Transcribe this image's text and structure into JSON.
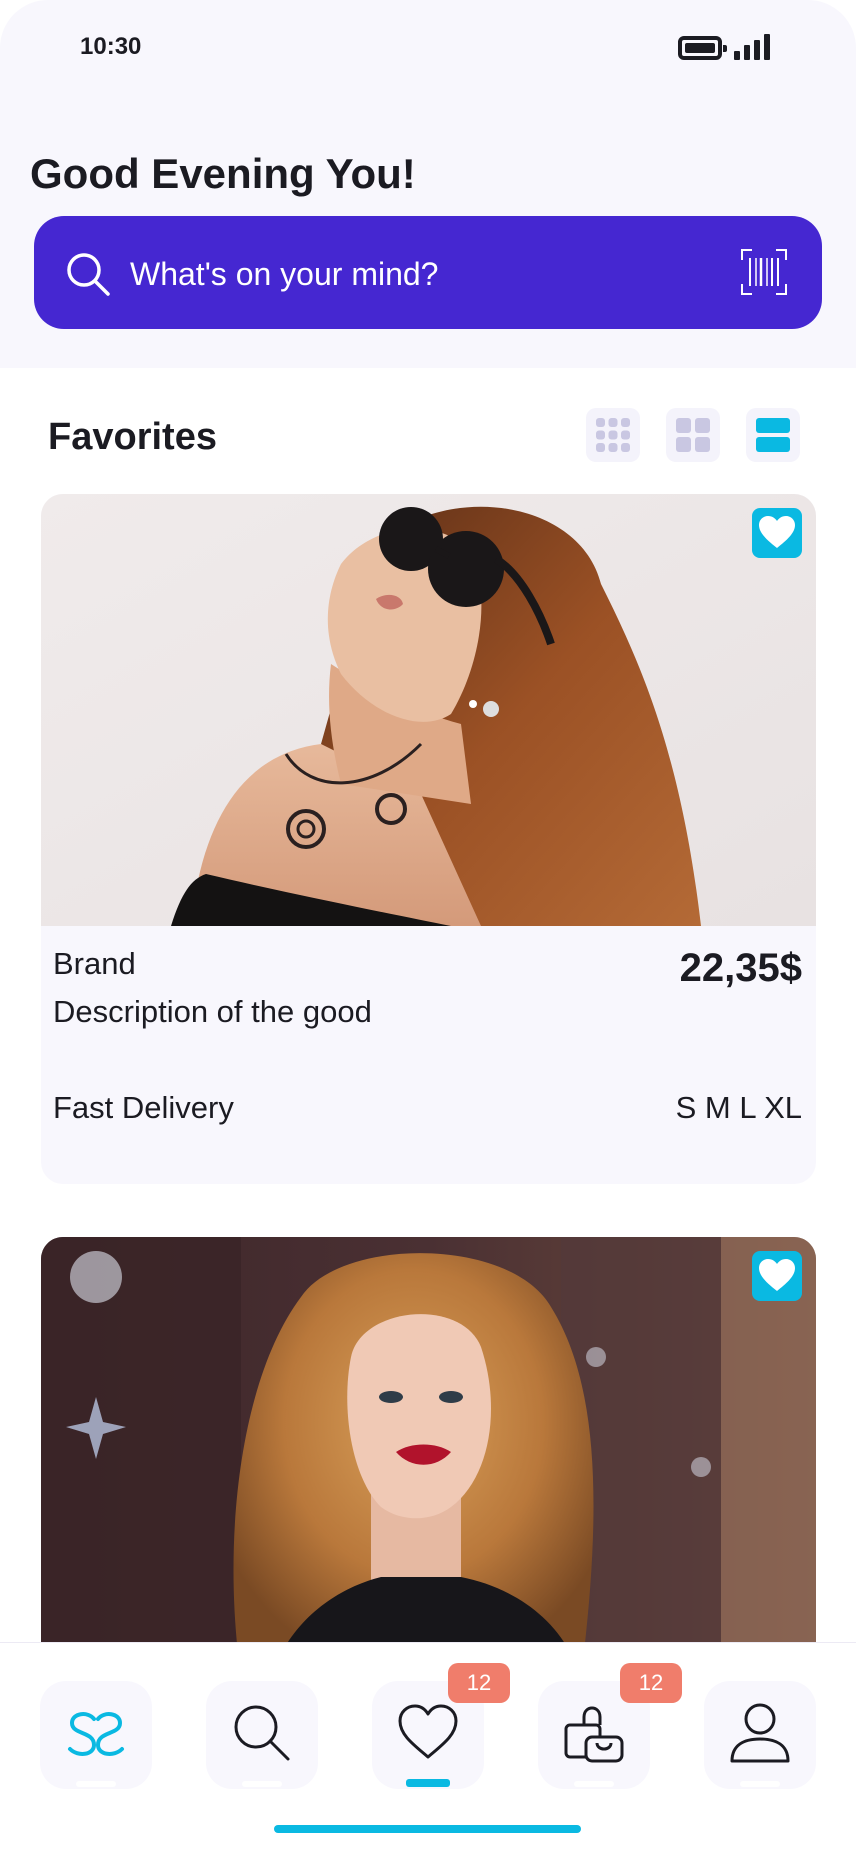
{
  "status_bar": {
    "time": "10:30"
  },
  "header": {
    "greeting": "Good Evening You!",
    "search": {
      "placeholder": "What's on your mind?"
    }
  },
  "favorites": {
    "title": "Favorites",
    "view_modes": [
      "grid-3",
      "grid-2",
      "list"
    ],
    "active_view": "list"
  },
  "products": [
    {
      "brand": "Brand",
      "description": "Description of the good",
      "price": "22,35$",
      "delivery": "Fast Delivery",
      "sizes": "S M L XL",
      "favorited": true
    },
    {
      "favorited": true
    }
  ],
  "bottom_nav": {
    "items": [
      {
        "id": "home",
        "icon": "logo-icon",
        "active": false
      },
      {
        "id": "search",
        "icon": "search-icon",
        "active": false
      },
      {
        "id": "favorites",
        "icon": "heart-icon",
        "active": true,
        "badge": "12"
      },
      {
        "id": "cart",
        "icon": "shopping-bag-icon",
        "active": false,
        "badge": "12"
      },
      {
        "id": "profile",
        "icon": "user-icon",
        "active": false
      }
    ]
  },
  "colors": {
    "accent": "#0ab9e2",
    "search_bg": "#4527d1",
    "badge": "#f07d6b",
    "background": "#f8f7fd"
  }
}
